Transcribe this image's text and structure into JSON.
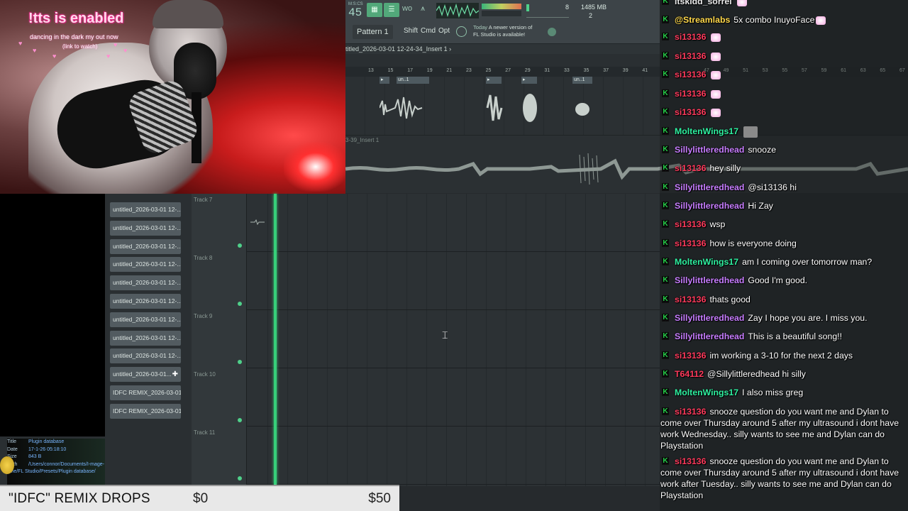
{
  "overlay": {
    "title": "!tts is enabled",
    "line1": "dancing in the dark my out now",
    "line2": "(link to watch)"
  },
  "toolbar": {
    "tempo": "45",
    "tempo_label": "M:S:CS",
    "memory": "1485 MB",
    "mem_num": "8",
    "cores": "2",
    "pattern": "Pattern 1",
    "shift": "Shift",
    "cmd": "Cmd",
    "opt": "Opt",
    "news_today": "Today",
    "news_text": "A newer version of",
    "news_text2": "FL Studio is available!"
  },
  "playlist": {
    "title": "titled_2026-03-01 12-24-34_Insert 1 ›",
    "insert_label": "3-39_Insert 1",
    "ruler": [
      "13",
      "15",
      "17",
      "19",
      "21",
      "23",
      "25",
      "27",
      "29",
      "31",
      "33",
      "35",
      "37",
      "39",
      "41"
    ],
    "ruler_right": [
      "47",
      "49",
      "51",
      "53",
      "55",
      "57",
      "59",
      "61",
      "63",
      "65",
      "67"
    ],
    "clip_labels": [
      "un..1",
      "un..1"
    ],
    "tracks": [
      "Track 7",
      "Track 8",
      "Track 9",
      "Track 10",
      "Track 11"
    ]
  },
  "browser": {
    "files": [
      "untitled_2026-03-01 12-...",
      "untitled_2026-03-01 12-...",
      "untitled_2026-03-01 12-...",
      "untitled_2026-03-01 12-...",
      "untitled_2026-03-01 12-...",
      "untitled_2026-03-01 12-...",
      "untitled_2026-03-01 12-...",
      "untitled_2026-03-01 12-...",
      "untitled_2026-03-01 12-...",
      "untitled_2026-03-01...",
      "IDFC REMIX_2026-03-01...",
      "IDFC REMIX_2026-03-01..."
    ],
    "meta": {
      "title_key": "Title",
      "title_val": "Plugin database",
      "date_key": "Date",
      "date_val": "17-1-26 05:18:10",
      "size_key": "Size",
      "size_val": "843 B",
      "path_key": "Path",
      "path_val": "/Users/connor/Documents/I-mage-Line/FL Studio/Presets/Plugin database/"
    }
  },
  "donation": {
    "title": "\"IDFC\" REMIX DROPS",
    "start": "$0",
    "goal": "$50"
  },
  "chat": [
    {
      "user": "itskidd_sorrel",
      "color": "#e9e9e9",
      "text": ""
    },
    {
      "user": "@Streamlabs",
      "color": "#ffd84a",
      "text": "5x combo InuyoFace"
    },
    {
      "user": "si13136",
      "color": "#ff3a5c",
      "text": ""
    },
    {
      "user": "si13136",
      "color": "#ff3a5c",
      "text": ""
    },
    {
      "user": "si13136",
      "color": "#ff3a5c",
      "text": ""
    },
    {
      "user": "si13136",
      "color": "#ff3a5c",
      "text": ""
    },
    {
      "user": "si13136",
      "color": "#ff3a5c",
      "text": ""
    },
    {
      "user": "MoltenWings17",
      "color": "#2ef0a0",
      "text": ""
    },
    {
      "user": "Sillylittleredhead",
      "color": "#c77dff",
      "text": "snooze"
    },
    {
      "user": "si13136",
      "color": "#ff3a5c",
      "text": "hey silly"
    },
    {
      "user": "Sillylittleredhead",
      "color": "#c77dff",
      "text": "@si13136 hi"
    },
    {
      "user": "Sillylittleredhead",
      "color": "#c77dff",
      "text": "Hi Zay"
    },
    {
      "user": "si13136",
      "color": "#ff3a5c",
      "text": "wsp"
    },
    {
      "user": "si13136",
      "color": "#ff3a5c",
      "text": "how is everyone doing"
    },
    {
      "user": "MoltenWings17",
      "color": "#2ef0a0",
      "text": "am I coming over tomorrow man?"
    },
    {
      "user": "Sillylittleredhead",
      "color": "#c77dff",
      "text": "Good I'm good."
    },
    {
      "user": "si13136",
      "color": "#ff3a5c",
      "text": "thats good"
    },
    {
      "user": "Sillylittleredhead",
      "color": "#c77dff",
      "text": "Zay I hope you are. I miss you."
    },
    {
      "user": "Sillylittleredhead",
      "color": "#c77dff",
      "text": "This is a beautiful song!!"
    },
    {
      "user": "si13136",
      "color": "#ff3a5c",
      "text": "im working a 3-10 for the next 2 days"
    },
    {
      "user": "T64112",
      "color": "#ff3a5c",
      "text": "@Sillylittleredhead hi silly"
    },
    {
      "user": "MoltenWings17",
      "color": "#2ef0a0",
      "text": "I also miss greg"
    },
    {
      "user": "si13136",
      "color": "#ff3a5c",
      "text": "snooze question do you want me and Dylan to come over Thursday around 5 after my ultrasound i dont have work Wednesday.. silly wants to see me and Dylan can do Playstation"
    },
    {
      "user": "si13136",
      "color": "#ff3a5c",
      "text": "snooze question do you want me and Dylan to come over Thursday around 5 after my ultrasound i dont have work after Tuesday.. silly wants to see me and Dylan can do Playstation"
    }
  ]
}
